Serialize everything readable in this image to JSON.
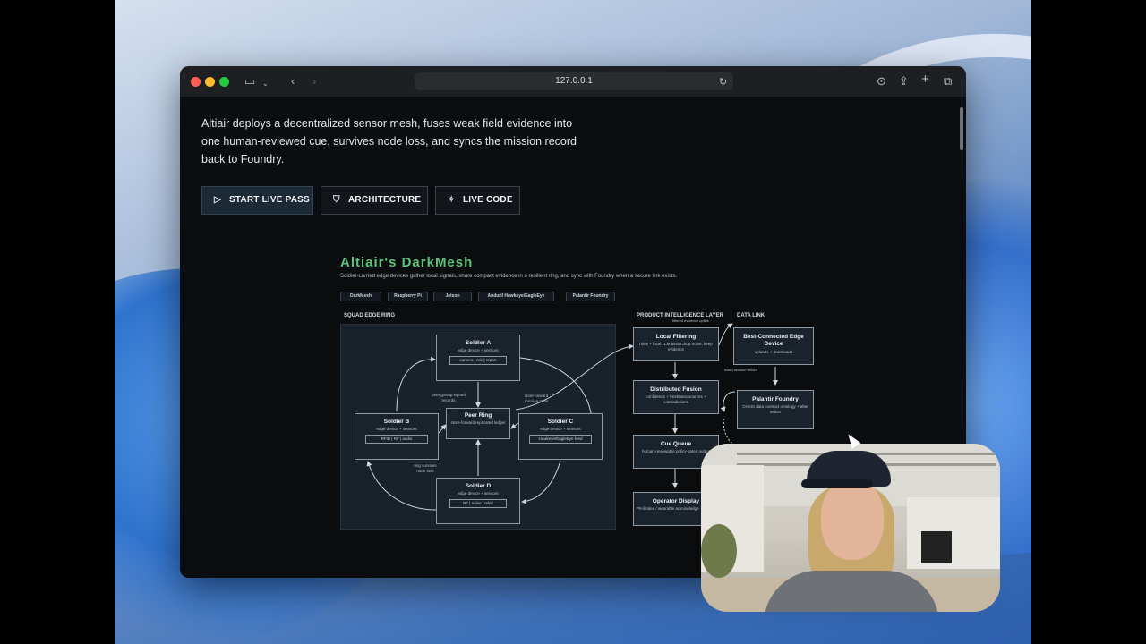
{
  "browser": {
    "url": "127.0.0.1",
    "traffic_colors": [
      "#ff5f57",
      "#febc2e",
      "#28c840"
    ]
  },
  "page": {
    "intro": "Altiair deploys a decentralized sensor mesh, fuses weak field evidence into one human-reviewed cue, survives node loss, and syncs the mission record back to Foundry.",
    "buttons": [
      {
        "label": "START LIVE PASS",
        "icon": "play-icon"
      },
      {
        "label": "ARCHITECTURE",
        "icon": "shield-icon"
      },
      {
        "label": "LIVE CODE",
        "icon": "crosshair-icon"
      }
    ]
  },
  "diagram": {
    "title": "Altiair's DarkMesh",
    "subtitle": "Soldier-carried edge devices gather local signals, share compact evidence in a resilient ring, and sync with Foundry when a secure link exists.",
    "chips": [
      "DarkMesh",
      "Raspberry Pi",
      "Jetson",
      "Anduril Hawkeye/EagleEye",
      "Palantir Foundry"
    ],
    "sections": {
      "ring": "SQUAD EDGE RING",
      "product": "PRODUCT INTELLIGENCE LAYER",
      "datalink": "DATA LINK"
    },
    "ring": {
      "soldier_a": {
        "title": "Soldier A",
        "sub": "edge device + sensors",
        "pill": "camera | mic | report"
      },
      "soldier_b": {
        "title": "Soldier B",
        "sub": "edge device + sensors",
        "pill": "RFID | RF | audio"
      },
      "soldier_c": {
        "title": "Soldier C",
        "sub": "edge device + sensors",
        "pill": "Hawkeye/EagleEye feed"
      },
      "soldier_d": {
        "title": "Soldier D",
        "sub": "edge device + sensors",
        "pill": "RF | noise | relay"
      },
      "peer_ring": {
        "title": "Peer Ring",
        "sub": "store-forward replicated ledger"
      },
      "notes": {
        "gossip": "peer gossip signed records",
        "store_forward": "store-forward mission state",
        "survives": "ring survives node loss"
      }
    },
    "pipeline": {
      "local_filtering": {
        "title": "Local Filtering",
        "sub": "rules + local LLM assist drop noise, keep evidence"
      },
      "distributed_fusion": {
        "title": "Distributed Fusion",
        "sub": "confidence + freshness sources + contradictions"
      },
      "cue_queue": {
        "title": "Cue Queue",
        "sub": "human-reviewable policy-gated output"
      },
      "operator_display": {
        "title": "Operator Display",
        "sub": "PII-limited / wearable acknowledge + review"
      },
      "best_connected": {
        "title": "Best-Connected Edge Device",
        "sub": "uploads + downloads"
      },
      "palantir_foundry": {
        "title": "Palantir Foundry",
        "sub": "OASIS data contract ontology + after action"
      },
      "notes": {
        "filtered": "filtered evidence uplink",
        "fused": "fused mission record"
      }
    }
  }
}
